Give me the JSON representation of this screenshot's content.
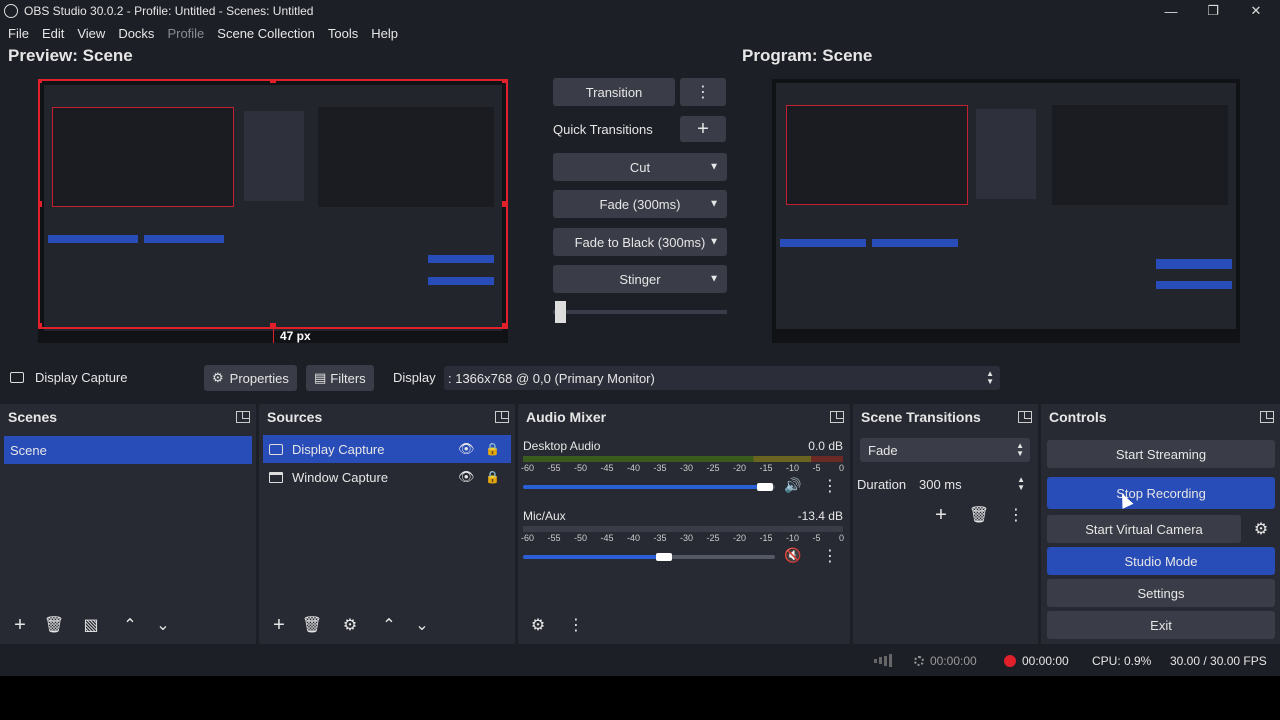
{
  "window": {
    "title": "OBS Studio 30.0.2 - Profile: Untitled - Scenes: Untitled",
    "minimize": "—",
    "restore": "❐",
    "close": "✕"
  },
  "menu": [
    "File",
    "Edit",
    "View",
    "Docks",
    "Profile",
    "Scene Collection",
    "Tools",
    "Help"
  ],
  "preview": {
    "label": "Preview: Scene",
    "dimension_label": "47 px"
  },
  "program": {
    "label": "Program: Scene"
  },
  "transitions": {
    "transition_button": "Transition",
    "quick_transitions_label": "Quick Transitions",
    "items": [
      "Cut",
      "Fade (300ms)",
      "Fade to Black (300ms)",
      "Stinger"
    ]
  },
  "properties_bar": {
    "source_name": "Display Capture",
    "properties_button": "Properties",
    "filters_button": "Filters",
    "display_label": "Display",
    "display_value": ": 1366x768 @ 0,0 (Primary Monitor)"
  },
  "scenes": {
    "title": "Scenes",
    "items": [
      "Scene"
    ]
  },
  "sources": {
    "title": "Sources",
    "items": [
      "Display Capture",
      "Window Capture"
    ]
  },
  "audio_mixer": {
    "title": "Audio Mixer",
    "channels": [
      {
        "name": "Desktop Audio",
        "level": "0.0 dB",
        "volume_fraction": 0.96
      },
      {
        "name": "Mic/Aux",
        "level": "-13.4 dB",
        "volume_fraction": 0.56
      }
    ],
    "scale": [
      "-60",
      "-55",
      "-50",
      "-45",
      "-40",
      "-35",
      "-30",
      "-25",
      "-20",
      "-15",
      "-10",
      "-5",
      "0"
    ]
  },
  "scene_transitions": {
    "title": "Scene Transitions",
    "selected": "Fade",
    "duration_label": "Duration",
    "duration_value": "300 ms"
  },
  "controls": {
    "title": "Controls",
    "start_streaming": "Start Streaming",
    "stop_recording": "Stop Recording",
    "start_virtual_camera": "Start Virtual Camera",
    "studio_mode": "Studio Mode",
    "settings": "Settings",
    "exit": "Exit"
  },
  "status": {
    "stream_time": "00:00:00",
    "record_time": "00:00:00",
    "cpu": "CPU: 0.9%",
    "fps": "30.00 / 30.00 FPS"
  },
  "colors": {
    "accent": "#284cb8",
    "background": "#1d1f26",
    "dock": "#272a33",
    "button": "#3a3d47",
    "selection_red": "#e0202a",
    "record_red": "#e0202a"
  }
}
